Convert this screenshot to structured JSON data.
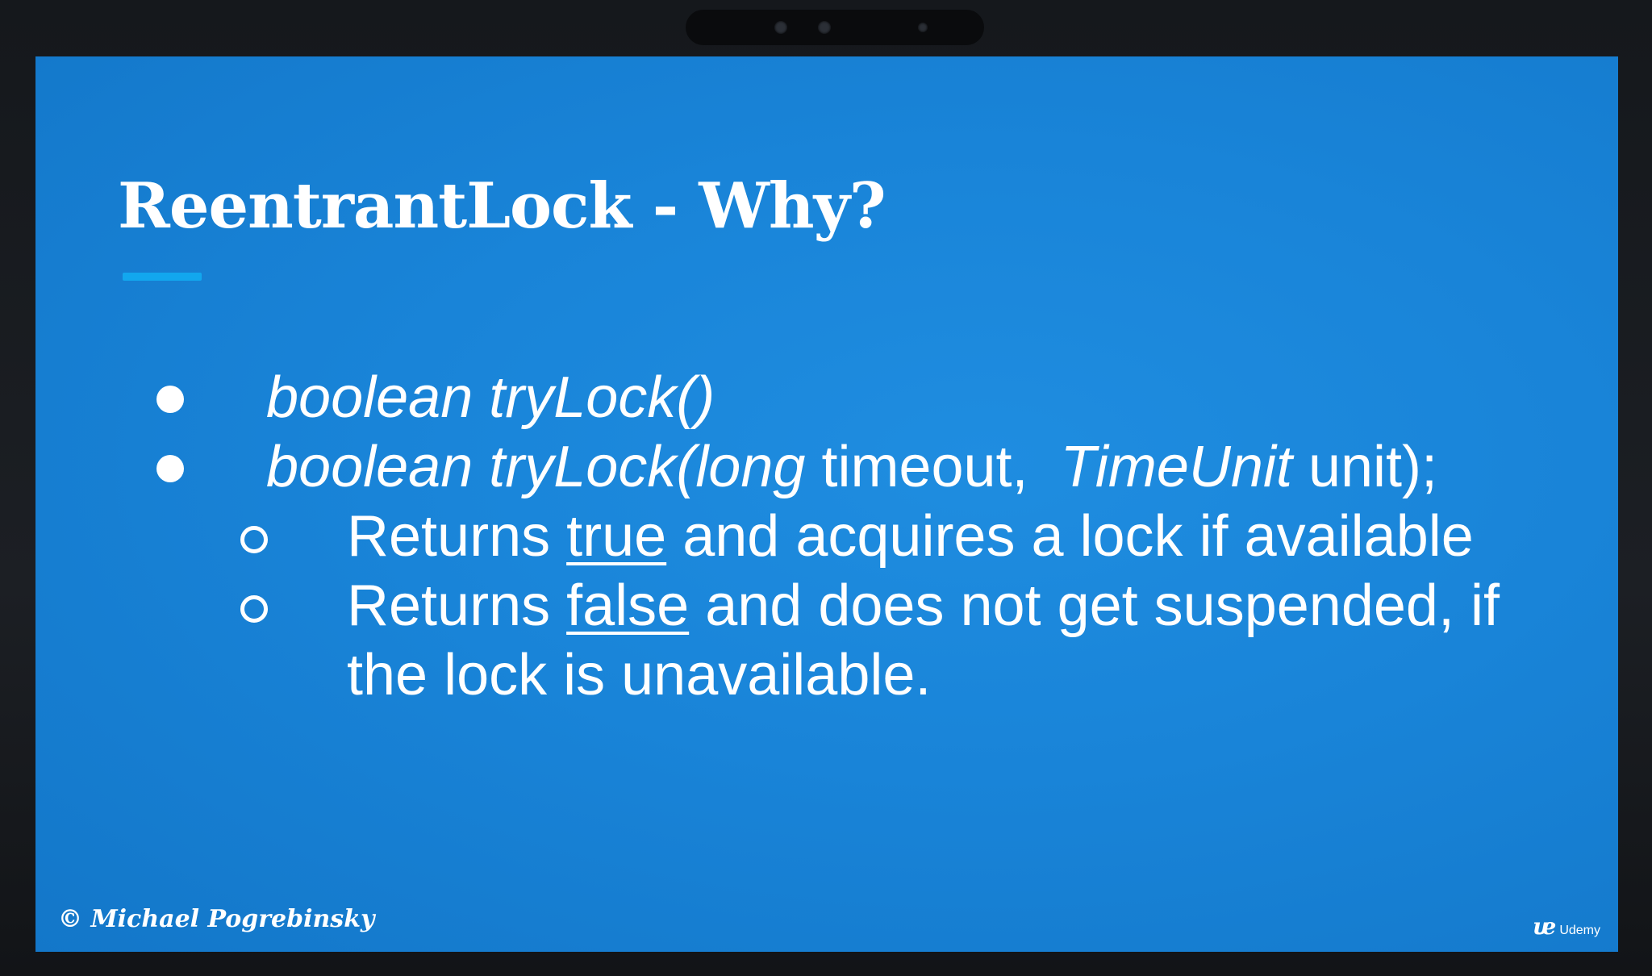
{
  "slide": {
    "title": "ReentrantLock - Why?",
    "bullet1": {
      "text": "boolean tryLock()"
    },
    "bullet2": {
      "part_boolean_trylock": "boolean tryLock(",
      "part_long": "long",
      "part_timeout": " timeout,  ",
      "part_timeunit": "TimeUnit",
      "part_unit": " unit);"
    },
    "sub1": {
      "prefix": "Returns ",
      "emphasis": "true",
      "suffix": " and acquires a lock if available"
    },
    "sub2": {
      "prefix": "Returns ",
      "emphasis": "false",
      "suffix": " and does not get suspended, if",
      "continuation": "the lock is unavailable."
    }
  },
  "footer": {
    "copyright": "© Michael Pogrebinsky",
    "brand_mark": "ᵫ",
    "brand_name": "Udemy"
  },
  "colors": {
    "slide_background": "#1984d8",
    "title_underline": "#12a7ee",
    "text": "#ffffff"
  }
}
